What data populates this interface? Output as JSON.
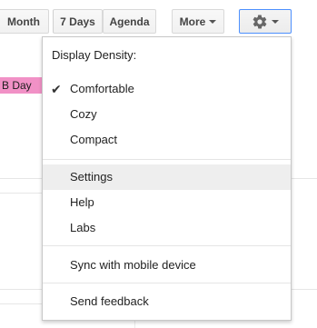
{
  "toolbar": {
    "month_label": "Month",
    "seven_days_label": "7 Days",
    "agenda_label": "Agenda",
    "more_label": "More",
    "gear_icon": "gear-icon"
  },
  "calendar": {
    "event_label": "B Day",
    "event_color": "#f191c6"
  },
  "menu": {
    "density_header": "Display Density:",
    "density_options": [
      {
        "label": "Comfortable",
        "checked": true
      },
      {
        "label": "Cozy",
        "checked": false
      },
      {
        "label": "Compact",
        "checked": false
      }
    ],
    "items": [
      {
        "label": "Settings",
        "highlighted": true
      },
      {
        "label": "Help",
        "highlighted": false
      },
      {
        "label": "Labs",
        "highlighted": false
      }
    ],
    "sync_label": "Sync with mobile device",
    "feedback_label": "Send feedback",
    "check_glyph": "✔"
  },
  "colors": {
    "accent_border": "#4d90fe",
    "highlight_bg": "#eeeeee"
  }
}
